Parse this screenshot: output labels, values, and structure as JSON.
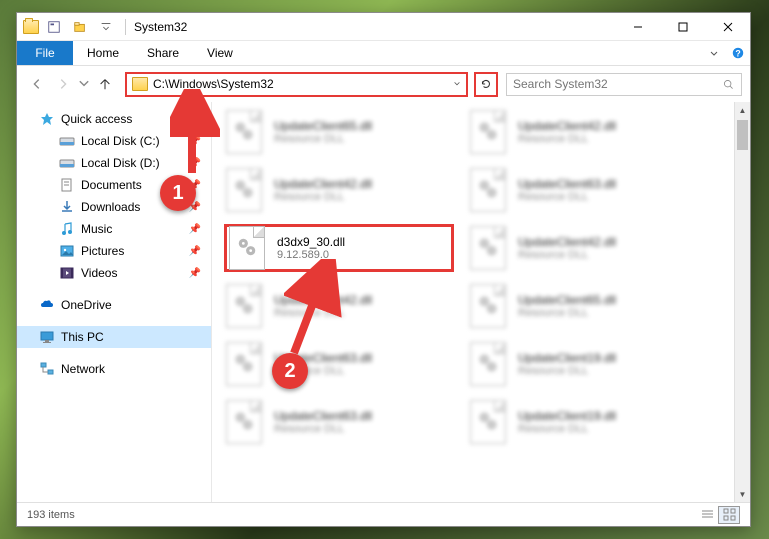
{
  "window": {
    "title": "System32"
  },
  "ribbon": {
    "file": "File",
    "tabs": [
      "Home",
      "Share",
      "View"
    ]
  },
  "nav": {
    "path": "C:\\Windows\\System32",
    "search_placeholder": "Search System32"
  },
  "sidebar": {
    "quick_access": "Quick access",
    "items": [
      {
        "label": "Local Disk (C:)",
        "icon": "disk",
        "pinned": true
      },
      {
        "label": "Local Disk (D:)",
        "icon": "disk",
        "pinned": true
      },
      {
        "label": "Documents",
        "icon": "folder",
        "pinned": true
      },
      {
        "label": "Downloads",
        "icon": "folder",
        "pinned": true
      },
      {
        "label": "Music",
        "icon": "music",
        "pinned": true
      },
      {
        "label": "Pictures",
        "icon": "pictures",
        "pinned": true
      },
      {
        "label": "Videos",
        "icon": "videos",
        "pinned": true
      }
    ],
    "onedrive": "OneDrive",
    "thispc": "This PC",
    "network": "Network"
  },
  "files": {
    "col1": [
      {
        "name": "UpdateClient65.dll",
        "sub": "Resource DLL"
      },
      {
        "name": "UpdateClient42.dll",
        "sub": "Resource DLL"
      },
      {
        "name": "d3dx9_30.dll",
        "sub": "9.12.589.0",
        "highlighted": true
      },
      {
        "name": "UpdateClient42.dll",
        "sub": "Resource DLL"
      },
      {
        "name": "UpdateClient63.dll",
        "sub": "Resource DLL"
      },
      {
        "name": "UpdateClient63.dll",
        "sub": "Resource DLL"
      }
    ],
    "col2": [
      {
        "name": "UpdateClient42.dll",
        "sub": "Resource DLL"
      },
      {
        "name": "UpdateClient63.dll",
        "sub": "Resource DLL"
      },
      {
        "name": "UpdateClient42.dll",
        "sub": "Resource DLL"
      },
      {
        "name": "UpdateClient65.dll",
        "sub": "Resource DLL"
      },
      {
        "name": "UpdateClient19.dll",
        "sub": "Resource DLL"
      },
      {
        "name": "UpdateClient19.dll",
        "sub": "Resource DLL"
      }
    ]
  },
  "status": {
    "count": "193 items"
  },
  "callouts": {
    "c1": "1",
    "c2": "2"
  }
}
